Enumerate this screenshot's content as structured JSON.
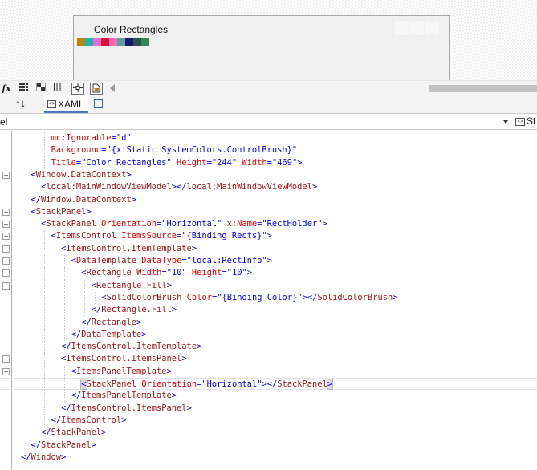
{
  "designer": {
    "window_title": "Color Rectangles",
    "rect_colors": [
      "#b8860b",
      "#20b2aa",
      "#da70d6",
      "#dc143c",
      "#ff69b4",
      "#5f9ea0",
      "#191970",
      "#2f4f4f",
      "#2e8b57"
    ]
  },
  "zoom_bar": {
    "fx_label": "fx"
  },
  "tabs": {
    "swap_label": "↑↓",
    "xaml_tab_label": "XAML"
  },
  "navbar": {
    "left_text": "el",
    "right_text": "St"
  },
  "code_lines": [
    {
      "indent": 6,
      "tokens": [
        {
          "t": "attr",
          "v": "mc:Ignorable"
        },
        {
          "t": "pun",
          "v": "="
        },
        {
          "t": "val",
          "v": "\"d\""
        }
      ]
    },
    {
      "indent": 6,
      "tokens": [
        {
          "t": "attr",
          "v": "Background"
        },
        {
          "t": "pun",
          "v": "="
        },
        {
          "t": "val",
          "v": "\"{x:Static SystemColors.ControlBrush}\""
        }
      ]
    },
    {
      "indent": 6,
      "tokens": [
        {
          "t": "attr",
          "v": "Title"
        },
        {
          "t": "pun",
          "v": "="
        },
        {
          "t": "val",
          "v": "\"Color Rectangles\""
        },
        {
          "t": "attr",
          "v": " Height"
        },
        {
          "t": "pun",
          "v": "="
        },
        {
          "t": "val",
          "v": "\"244\""
        },
        {
          "t": "attr",
          "v": " Width"
        },
        {
          "t": "pun",
          "v": "="
        },
        {
          "t": "val",
          "v": "\"469\""
        },
        {
          "t": "pun",
          "v": ">"
        }
      ]
    },
    {
      "indent": 2,
      "fold": "-",
      "tokens": [
        {
          "t": "pun",
          "v": "<"
        },
        {
          "t": "tag",
          "v": "Window.DataContext"
        },
        {
          "t": "pun",
          "v": ">"
        }
      ]
    },
    {
      "indent": 4,
      "tokens": [
        {
          "t": "pun",
          "v": "<"
        },
        {
          "t": "tag",
          "v": "local:MainWindowViewModel"
        },
        {
          "t": "pun",
          "v": "></"
        },
        {
          "t": "tag",
          "v": "local:MainWindowViewModel"
        },
        {
          "t": "pun",
          "v": ">"
        }
      ]
    },
    {
      "indent": 2,
      "tokens": [
        {
          "t": "pun",
          "v": "</"
        },
        {
          "t": "tag",
          "v": "Window.DataContext"
        },
        {
          "t": "pun",
          "v": ">"
        }
      ]
    },
    {
      "indent": 2,
      "fold": "-",
      "tokens": [
        {
          "t": "pun",
          "v": "<"
        },
        {
          "t": "tag",
          "v": "StackPanel"
        },
        {
          "t": "pun",
          "v": ">"
        }
      ]
    },
    {
      "indent": 4,
      "fold": "-",
      "tokens": [
        {
          "t": "pun",
          "v": "<"
        },
        {
          "t": "tag",
          "v": "StackPanel"
        },
        {
          "t": "attr",
          "v": " Orientation"
        },
        {
          "t": "pun",
          "v": "="
        },
        {
          "t": "val",
          "v": "\"Horizontal\""
        },
        {
          "t": "attr",
          "v": " x:Name"
        },
        {
          "t": "pun",
          "v": "="
        },
        {
          "t": "val",
          "v": "\"RectHolder\""
        },
        {
          "t": "pun",
          "v": ">"
        }
      ]
    },
    {
      "indent": 6,
      "fold": "-",
      "tokens": [
        {
          "t": "pun",
          "v": "<"
        },
        {
          "t": "tag",
          "v": "ItemsControl"
        },
        {
          "t": "attr",
          "v": " ItemsSource"
        },
        {
          "t": "pun",
          "v": "="
        },
        {
          "t": "val",
          "v": "\"{Binding Rects}\""
        },
        {
          "t": "pun",
          "v": ">"
        }
      ]
    },
    {
      "indent": 8,
      "fold": "-",
      "tokens": [
        {
          "t": "pun",
          "v": "<"
        },
        {
          "t": "tag",
          "v": "ItemsControl.ItemTemplate"
        },
        {
          "t": "pun",
          "v": ">"
        }
      ]
    },
    {
      "indent": 10,
      "fold": "-",
      "tokens": [
        {
          "t": "pun",
          "v": "<"
        },
        {
          "t": "tag",
          "v": "DataTemplate"
        },
        {
          "t": "attr",
          "v": " DataType"
        },
        {
          "t": "pun",
          "v": "="
        },
        {
          "t": "val",
          "v": "\"local:RectInfo\""
        },
        {
          "t": "pun",
          "v": ">"
        }
      ]
    },
    {
      "indent": 12,
      "fold": "-",
      "tokens": [
        {
          "t": "pun",
          "v": "<"
        },
        {
          "t": "tag",
          "v": "Rectangle"
        },
        {
          "t": "attr",
          "v": " Width"
        },
        {
          "t": "pun",
          "v": "="
        },
        {
          "t": "val",
          "v": "\"10\""
        },
        {
          "t": "attr",
          "v": " Height"
        },
        {
          "t": "pun",
          "v": "="
        },
        {
          "t": "val",
          "v": "\"10\""
        },
        {
          "t": "pun",
          "v": ">"
        }
      ]
    },
    {
      "indent": 14,
      "fold": "-",
      "tokens": [
        {
          "t": "pun",
          "v": "<"
        },
        {
          "t": "tag",
          "v": "Rectangle.Fill"
        },
        {
          "t": "pun",
          "v": ">"
        }
      ]
    },
    {
      "indent": 16,
      "tokens": [
        {
          "t": "pun",
          "v": "<"
        },
        {
          "t": "tag",
          "v": "SolidColorBrush"
        },
        {
          "t": "attr",
          "v": " Color"
        },
        {
          "t": "pun",
          "v": "="
        },
        {
          "t": "val",
          "v": "\"{Binding Color}\""
        },
        {
          "t": "pun",
          "v": "></"
        },
        {
          "t": "tag",
          "v": "SolidColorBrush"
        },
        {
          "t": "pun",
          "v": ">"
        }
      ]
    },
    {
      "indent": 14,
      "tokens": [
        {
          "t": "pun",
          "v": "</"
        },
        {
          "t": "tag",
          "v": "Rectangle.Fill"
        },
        {
          "t": "pun",
          "v": ">"
        }
      ]
    },
    {
      "indent": 12,
      "tokens": [
        {
          "t": "pun",
          "v": "</"
        },
        {
          "t": "tag",
          "v": "Rectangle"
        },
        {
          "t": "pun",
          "v": ">"
        }
      ]
    },
    {
      "indent": 10,
      "tokens": [
        {
          "t": "pun",
          "v": "</"
        },
        {
          "t": "tag",
          "v": "DataTemplate"
        },
        {
          "t": "pun",
          "v": ">"
        }
      ]
    },
    {
      "indent": 8,
      "tokens": [
        {
          "t": "pun",
          "v": "</"
        },
        {
          "t": "tag",
          "v": "ItemsControl.ItemTemplate"
        },
        {
          "t": "pun",
          "v": ">"
        }
      ]
    },
    {
      "indent": 8,
      "fold": "-",
      "tokens": [
        {
          "t": "pun",
          "v": "<"
        },
        {
          "t": "tag",
          "v": "ItemsControl.ItemsPanel"
        },
        {
          "t": "pun",
          "v": ">"
        }
      ]
    },
    {
      "indent": 10,
      "fold": "-",
      "tokens": [
        {
          "t": "pun",
          "v": "<"
        },
        {
          "t": "tag",
          "v": "ItemsPanelTemplate"
        },
        {
          "t": "pun",
          "v": ">"
        }
      ]
    },
    {
      "indent": 12,
      "current": true,
      "tokens": [
        {
          "t": "pun",
          "v": "<",
          "br": true
        },
        {
          "t": "tag",
          "v": "StackPanel"
        },
        {
          "t": "attr",
          "v": " Orientation"
        },
        {
          "t": "pun",
          "v": "="
        },
        {
          "t": "val",
          "v": "\"Horizontal\""
        },
        {
          "t": "pun",
          "v": "></"
        },
        {
          "t": "tag",
          "v": "StackPanel"
        },
        {
          "t": "pun",
          "v": ">",
          "br": true
        }
      ]
    },
    {
      "indent": 10,
      "tokens": [
        {
          "t": "pun",
          "v": "</"
        },
        {
          "t": "tag",
          "v": "ItemsPanelTemplate"
        },
        {
          "t": "pun",
          "v": ">"
        }
      ]
    },
    {
      "indent": 8,
      "tokens": [
        {
          "t": "pun",
          "v": "</"
        },
        {
          "t": "tag",
          "v": "ItemsControl.ItemsPanel"
        },
        {
          "t": "pun",
          "v": ">"
        }
      ]
    },
    {
      "indent": 6,
      "tokens": [
        {
          "t": "pun",
          "v": "</"
        },
        {
          "t": "tag",
          "v": "ItemsControl"
        },
        {
          "t": "pun",
          "v": ">"
        }
      ]
    },
    {
      "indent": 4,
      "tokens": [
        {
          "t": "pun",
          "v": "</"
        },
        {
          "t": "tag",
          "v": "StackPanel"
        },
        {
          "t": "pun",
          "v": ">"
        }
      ]
    },
    {
      "indent": 2,
      "tokens": [
        {
          "t": "pun",
          "v": "</"
        },
        {
          "t": "tag",
          "v": "StackPanel"
        },
        {
          "t": "pun",
          "v": ">"
        }
      ]
    },
    {
      "indent": 0,
      "tokens": [
        {
          "t": "pun",
          "v": "</"
        },
        {
          "t": "tag",
          "v": "Window"
        },
        {
          "t": "pun",
          "v": ">"
        }
      ]
    }
  ]
}
